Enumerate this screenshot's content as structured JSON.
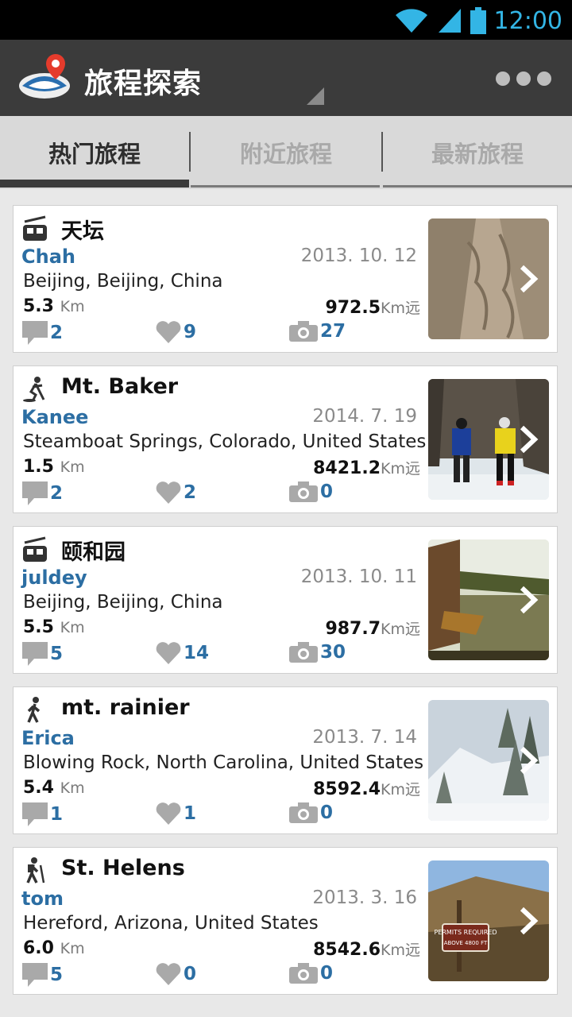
{
  "status": {
    "time": "12:00",
    "accent": "#33b5e5"
  },
  "app": {
    "title": "旅程探索",
    "bar_color": "#3b3b3b"
  },
  "tabs": [
    {
      "label": "热门旅程",
      "active": true
    },
    {
      "label": "附近旅程",
      "active": false
    },
    {
      "label": "最新旅程",
      "active": false
    }
  ],
  "trips": [
    {
      "icon": "cable-car-icon",
      "title": "天坛",
      "user": "Chah",
      "date": "2013. 10. 12",
      "location": "Beijing, Beijing, China",
      "distance": "5.3",
      "distance_unit": "Km",
      "far": "972.5",
      "far_unit": "Km远",
      "comments": "2",
      "likes": "9",
      "photos": "27",
      "photo": "stone-path"
    },
    {
      "icon": "snowshoe-icon",
      "title": "Mt. Baker",
      "user": "Kanee",
      "date": "2014. 7. 19",
      "location": "Steamboat Springs, Colorado, United States",
      "distance": "1.5",
      "distance_unit": "Km",
      "far": "8421.2",
      "far_unit": "Km远",
      "comments": "2",
      "likes": "2",
      "photos": "0",
      "photo": "snow-hikers"
    },
    {
      "icon": "cable-car-icon",
      "title": "颐和园",
      "user": "juldey",
      "date": "2013. 10. 11",
      "location": "Beijing, Beijing, China",
      "distance": "5.5",
      "distance_unit": "Km",
      "far": "987.7",
      "far_unit": "Km远",
      "comments": "5",
      "likes": "14",
      "photos": "30",
      "photo": "lake-pavilion"
    },
    {
      "icon": "walking-icon",
      "title": "mt. rainier",
      "user": "Erica",
      "date": "2013. 7. 14",
      "location": "Blowing Rock, North Carolina, United States",
      "distance": "5.4",
      "distance_unit": "Km",
      "far": "8592.4",
      "far_unit": "Km远",
      "comments": "1",
      "likes": "1",
      "photos": "0",
      "photo": "snow-forest"
    },
    {
      "icon": "hiking-icon",
      "title": "St. Helens",
      "user": "tom",
      "date": "2013. 3. 16",
      "location": "Hereford, Arizona, United States",
      "distance": "6.0",
      "distance_unit": "Km",
      "far": "8542.6",
      "far_unit": "Km远",
      "comments": "5",
      "likes": "0",
      "photos": "0",
      "photo": "permit-sign"
    }
  ],
  "sign_text": "PERMITS REQUIRED",
  "sign_sub": "ABOVE 4800 FT"
}
